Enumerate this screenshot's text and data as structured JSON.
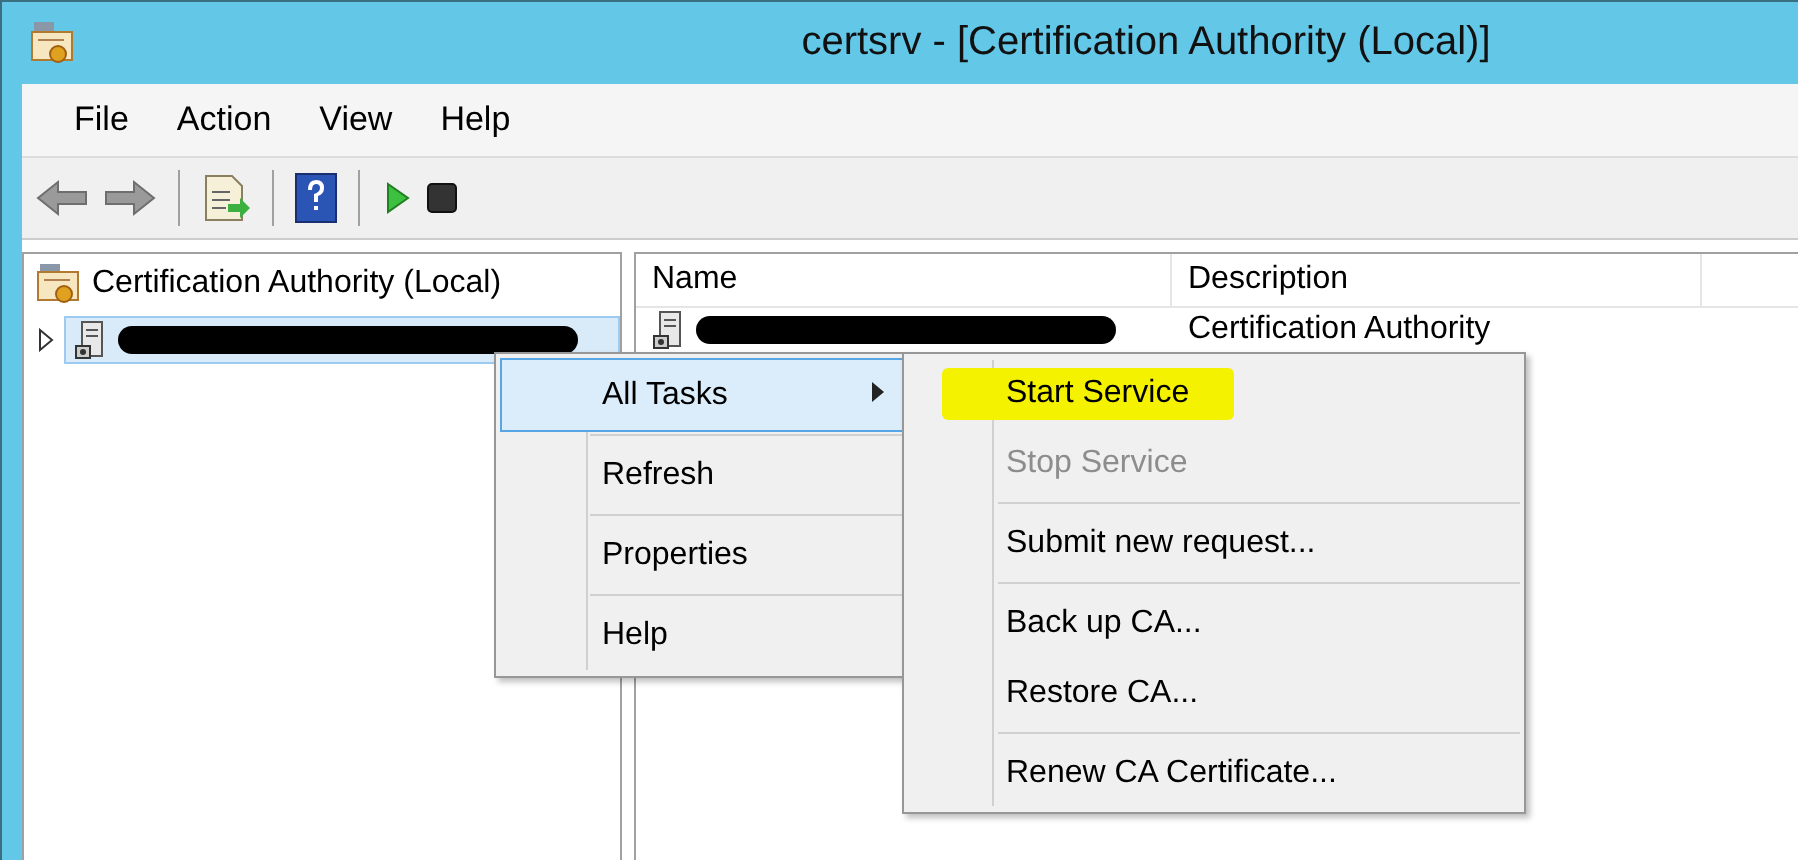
{
  "window": {
    "title": "certsrv - [Certification Authority (Local)]"
  },
  "menu_bar": [
    "File",
    "Action",
    "View",
    "Help"
  ],
  "toolbar": [
    {
      "kind": "back"
    },
    {
      "kind": "forward"
    },
    {
      "kind": "separator"
    },
    {
      "kind": "export"
    },
    {
      "kind": "separator"
    },
    {
      "kind": "help"
    },
    {
      "kind": "separator"
    },
    {
      "kind": "start"
    },
    {
      "kind": "stop"
    }
  ],
  "tree": {
    "root": "Certification Authority (Local)",
    "children": [
      {
        "redacted": true,
        "selected": true,
        "expanded": false
      }
    ]
  },
  "list": {
    "columns": [
      "Name",
      "Description"
    ],
    "rows": [
      {
        "name_redacted": true,
        "description": "Certification Authority"
      }
    ]
  },
  "context_menu": {
    "items": [
      {
        "kind": "item",
        "label": "All Tasks",
        "selected": true,
        "submenu": true
      },
      {
        "kind": "separator"
      },
      {
        "kind": "item",
        "label": "Refresh",
        "selected": false,
        "submenu": false
      },
      {
        "kind": "separator"
      },
      {
        "kind": "item",
        "label": "Properties",
        "selected": false,
        "submenu": false
      },
      {
        "kind": "separator"
      },
      {
        "kind": "item",
        "label": "Help",
        "selected": false,
        "submenu": false
      }
    ]
  },
  "submenu": {
    "items": [
      {
        "kind": "item",
        "label": "Start Service",
        "disabled": false,
        "highlighted": true
      },
      {
        "kind": "item",
        "label": "Stop Service",
        "disabled": true,
        "highlighted": false
      },
      {
        "kind": "separator"
      },
      {
        "kind": "item",
        "label": "Submit new request...",
        "disabled": false,
        "highlighted": false
      },
      {
        "kind": "separator"
      },
      {
        "kind": "item",
        "label": "Back up CA...",
        "disabled": false,
        "highlighted": false
      },
      {
        "kind": "item",
        "label": "Restore CA...",
        "disabled": false,
        "highlighted": false
      },
      {
        "kind": "separator"
      },
      {
        "kind": "item",
        "label": "Renew CA Certificate...",
        "disabled": false,
        "highlighted": false
      }
    ]
  }
}
